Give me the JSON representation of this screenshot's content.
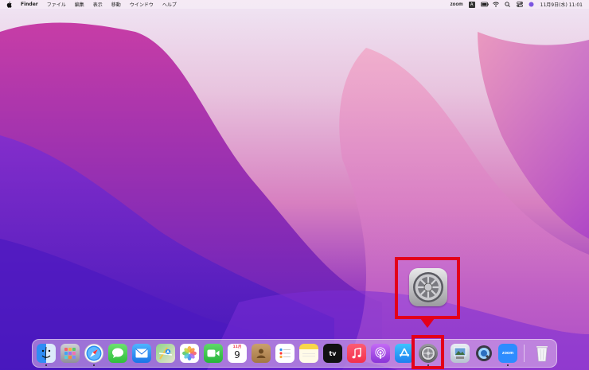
{
  "menubar": {
    "app_name": "Finder",
    "menus": [
      "ファイル",
      "編集",
      "表示",
      "移動",
      "ウインドウ",
      "ヘルプ"
    ],
    "status_zoom": "zoom",
    "status_input": "A",
    "datetime": "11月9日(水)  11:01"
  },
  "dock": {
    "items": [
      {
        "name": "Finder",
        "icon": "finder-icon",
        "running": true
      },
      {
        "name": "Launchpad",
        "icon": "launchpad-icon",
        "running": false
      },
      {
        "name": "Safari",
        "icon": "safari-icon",
        "running": true
      },
      {
        "name": "メッセージ",
        "icon": "messages-icon",
        "running": false
      },
      {
        "name": "メール",
        "icon": "mail-icon",
        "running": false
      },
      {
        "name": "マップ",
        "icon": "maps-icon",
        "running": false
      },
      {
        "name": "写真",
        "icon": "photos-icon",
        "running": false
      },
      {
        "name": "FaceTime",
        "icon": "facetime-icon",
        "running": false
      },
      {
        "name": "カレンダー",
        "icon": "calendar-icon",
        "running": false
      },
      {
        "name": "連絡先",
        "icon": "contacts-icon",
        "running": false
      },
      {
        "name": "リマインダー",
        "icon": "reminders-icon",
        "running": false
      },
      {
        "name": "メモ",
        "icon": "notes-icon",
        "running": false
      },
      {
        "name": "TV",
        "icon": "appletv-icon",
        "running": false
      },
      {
        "name": "ミュージック",
        "icon": "music-icon",
        "running": false
      },
      {
        "name": "Podcast",
        "icon": "podcasts-icon",
        "running": false
      },
      {
        "name": "App Store",
        "icon": "appstore-icon",
        "running": false
      },
      {
        "name": "システム環境設定",
        "icon": "system-preferences-icon",
        "running": true
      },
      {
        "name": "プレビュー",
        "icon": "preview-icon",
        "running": false
      },
      {
        "name": "QuickTime Player",
        "icon": "quicktime-icon",
        "running": false
      },
      {
        "name": "zoom.us",
        "icon": "zoom-icon",
        "running": true
      },
      {
        "name": "ゴミ箱",
        "icon": "trash-icon",
        "running": false
      }
    ],
    "calendar_month": "11月",
    "calendar_day": "9",
    "tv_label": "tv",
    "zoom_label": "zoom",
    "highlighted": "system-preferences-icon"
  },
  "colors": {
    "highlight": "#e3001b",
    "wallpaper_top": "#f0e6f4",
    "wallpaper_bottom": "#6f1fc8"
  }
}
